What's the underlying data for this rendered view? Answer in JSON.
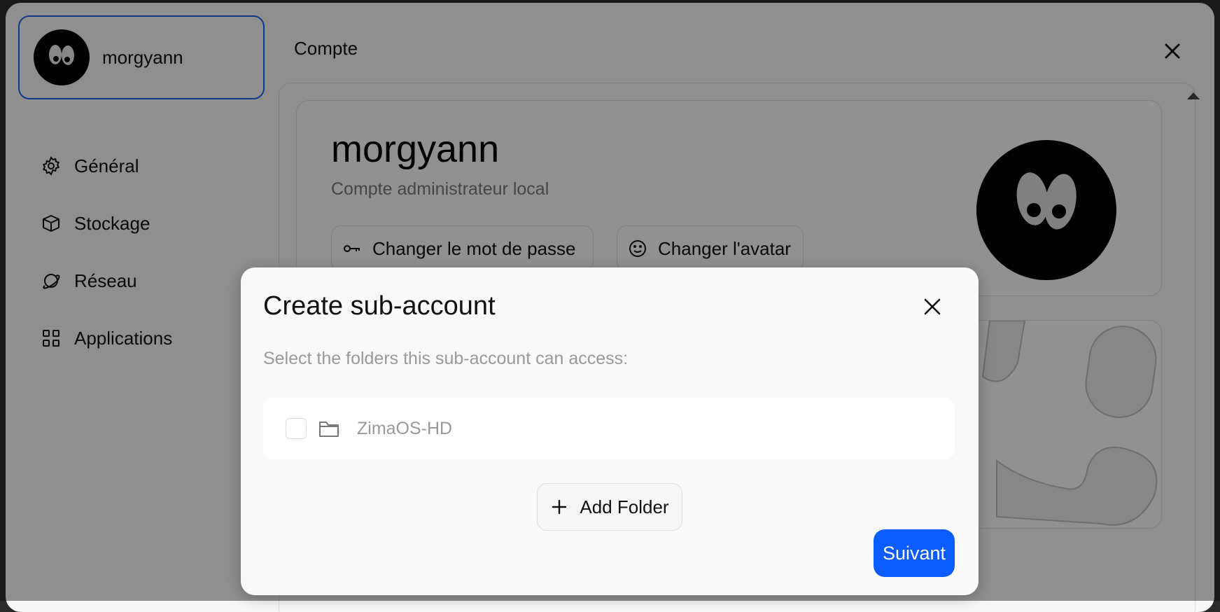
{
  "sidebar": {
    "user_name": "morgyann",
    "items": [
      {
        "label": "Général",
        "icon": "gear-icon"
      },
      {
        "label": "Stockage",
        "icon": "box-icon"
      },
      {
        "label": "Réseau",
        "icon": "planet-icon"
      },
      {
        "label": "Applications",
        "icon": "apps-grid-icon"
      }
    ]
  },
  "main": {
    "title": "Compte",
    "profile": {
      "name": "morgyann",
      "subtitle": "Compte administrateur local",
      "change_password_label": "Changer le mot de passe",
      "change_avatar_label": "Changer l'avatar"
    }
  },
  "modal": {
    "title": "Create sub-account",
    "description": "Select the folders this sub-account can access:",
    "folders": [
      {
        "name": "ZimaOS-HD",
        "checked": false
      }
    ],
    "add_folder_label": "Add Folder",
    "next_label": "Suivant"
  },
  "colors": {
    "accent": "#0a5cff",
    "selected_border": "#1a64f0"
  }
}
